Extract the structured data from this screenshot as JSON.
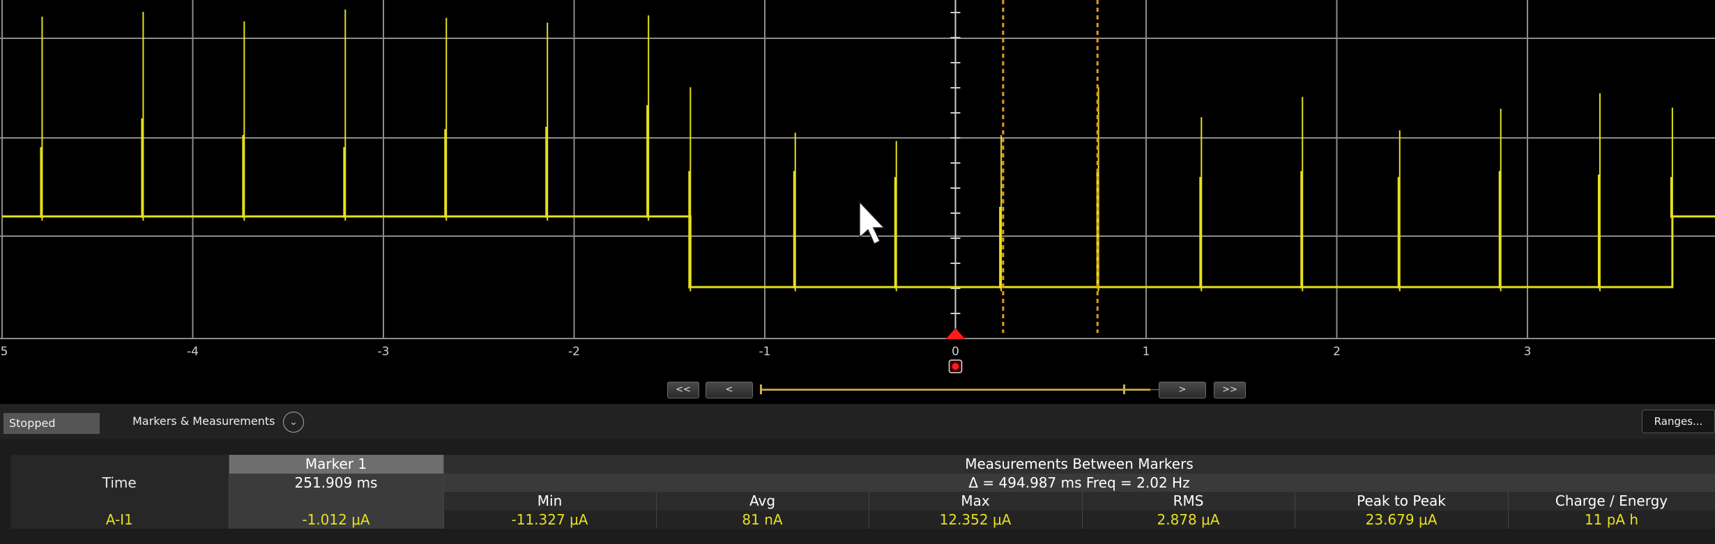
{
  "plot": {
    "x_tick_labels": [
      "5",
      "-4",
      "-3",
      "-2",
      "-1",
      "0",
      "1",
      "2",
      "3"
    ],
    "colors": {
      "trace": "#e6e01a",
      "grid": "#8c8c8c",
      "marker": "#e59a1c",
      "trigger": "#ff1a1a",
      "background": "#000000"
    }
  },
  "chart_data": {
    "type": "line",
    "xlim": [
      -5,
      4
    ],
    "x_ticks": [
      -5,
      -4,
      -3,
      -2,
      -1,
      0,
      1,
      2,
      3
    ],
    "ylim": [
      -22,
      6
    ],
    "grid": true,
    "baseline_levels": [
      {
        "from": -5.0,
        "to": -1.39,
        "level": -11.8
      },
      {
        "from": -1.39,
        "to": 3.76,
        "level": -17.7
      },
      {
        "from": 3.76,
        "to": 4.0,
        "level": -11.8
      }
    ],
    "spikes": [
      {
        "x": -4.79,
        "peak": 4.9,
        "shoulder": -6.0
      },
      {
        "x": -4.26,
        "peak": 5.3,
        "shoulder": -3.6
      },
      {
        "x": -3.73,
        "peak": 4.5,
        "shoulder": -5.0
      },
      {
        "x": -3.2,
        "peak": 5.5,
        "shoulder": -6.0
      },
      {
        "x": -2.67,
        "peak": 4.8,
        "shoulder": -4.5
      },
      {
        "x": -2.14,
        "peak": 4.4,
        "shoulder": -4.3
      },
      {
        "x": -1.61,
        "peak": 5.0,
        "shoulder": -2.5
      },
      {
        "x": -1.39,
        "peak": -1.0,
        "shoulder": -8.0
      },
      {
        "x": -0.84,
        "peak": -4.8,
        "shoulder": -8.0
      },
      {
        "x": -0.31,
        "peak": -5.5,
        "shoulder": -8.5
      },
      {
        "x": 0.24,
        "peak": -5.0,
        "shoulder": -11.0
      },
      {
        "x": 0.75,
        "peak": -1.0,
        "shoulder": -8.0
      },
      {
        "x": 1.29,
        "peak": -3.5,
        "shoulder": -8.5
      },
      {
        "x": 1.82,
        "peak": -1.8,
        "shoulder": -8.0
      },
      {
        "x": 2.33,
        "peak": -4.6,
        "shoulder": -8.5
      },
      {
        "x": 2.86,
        "peak": -2.8,
        "shoulder": -8.0
      },
      {
        "x": 3.38,
        "peak": -1.5,
        "shoulder": -8.3
      },
      {
        "x": 3.76,
        "peak": -2.7,
        "shoulder": -8.5
      }
    ],
    "markers_x": [
      0.25,
      0.745
    ],
    "trigger_x": 0.0
  },
  "navigator": {
    "first_label": "<<",
    "prev_label": "<",
    "next_label": ">",
    "last_label": ">>",
    "window_start_fraction": 0.0,
    "window_end_fraction": 1.0
  },
  "status": {
    "state": "Stopped"
  },
  "markers_panel": {
    "title": "Markers & Measurements",
    "toggle_icon": "chevron-down-icon"
  },
  "ranges_button": "Ranges...",
  "table": {
    "marker_header": "Marker 1",
    "row_time_label": "Time",
    "marker_time": "251.909 ms",
    "channel_label": "A-I1",
    "marker_value": "-1.012 μA",
    "meas_header": "Measurements Between Markers",
    "delta": "Δ = 494.987 ms   Freq = 2.02 Hz",
    "columns": [
      "Min",
      "Avg",
      "Max",
      "RMS",
      "Peak to Peak",
      "Charge / Energy"
    ],
    "values": [
      "-11.327 μA",
      "81 nA",
      "12.352 μA",
      "2.878 μA",
      "23.679 μA",
      "11 pA h"
    ]
  }
}
